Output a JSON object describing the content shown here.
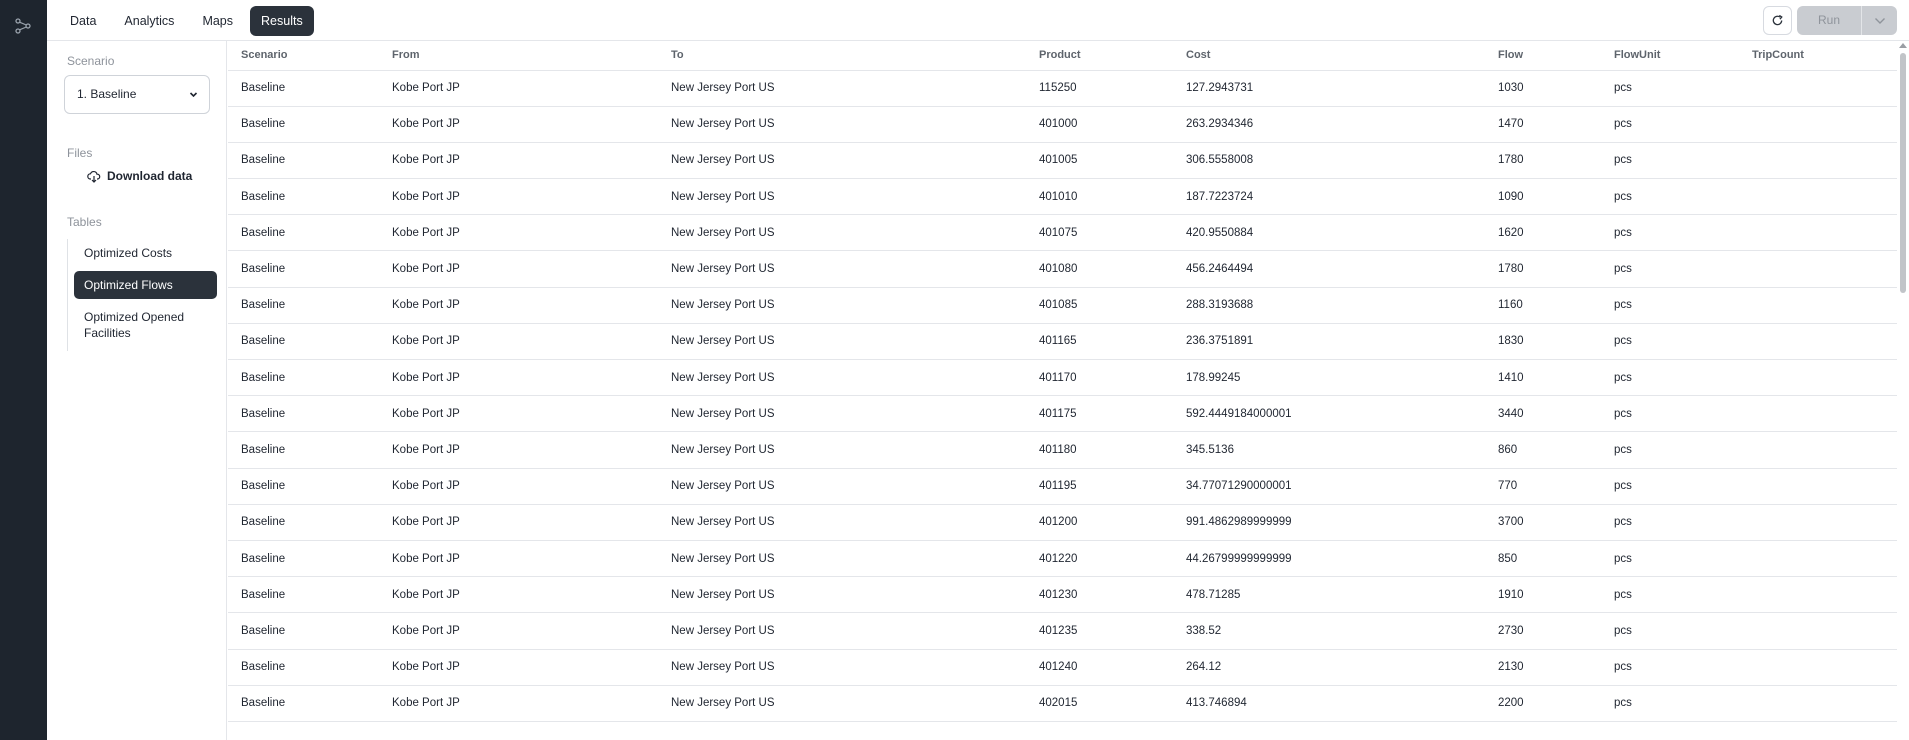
{
  "nav": {
    "tabs": [
      {
        "label": "Data",
        "active": false
      },
      {
        "label": "Analytics",
        "active": false
      },
      {
        "label": "Maps",
        "active": false
      },
      {
        "label": "Results",
        "active": true
      }
    ],
    "run_label": "Run"
  },
  "sidebar": {
    "scenario_title": "Scenario",
    "scenario_value": "1. Baseline",
    "files_title": "Files",
    "download_label": "Download data",
    "tables_title": "Tables",
    "tables": [
      {
        "label": "Optimized Costs",
        "active": false
      },
      {
        "label": "Optimized Flows",
        "active": true
      },
      {
        "label": "Optimized Opened Facilities",
        "active": false
      }
    ]
  },
  "table": {
    "headers": [
      "Scenario",
      "From",
      "To",
      "Product",
      "Cost",
      "Flow",
      "FlowUnit",
      "TripCount"
    ],
    "rows": [
      [
        "Baseline",
        "Kobe Port JP",
        "New Jersey Port US",
        "115250",
        "127.2943731",
        "1030",
        "pcs",
        ""
      ],
      [
        "Baseline",
        "Kobe Port JP",
        "New Jersey Port US",
        "401000",
        "263.2934346",
        "1470",
        "pcs",
        ""
      ],
      [
        "Baseline",
        "Kobe Port JP",
        "New Jersey Port US",
        "401005",
        "306.5558008",
        "1780",
        "pcs",
        ""
      ],
      [
        "Baseline",
        "Kobe Port JP",
        "New Jersey Port US",
        "401010",
        "187.7223724",
        "1090",
        "pcs",
        ""
      ],
      [
        "Baseline",
        "Kobe Port JP",
        "New Jersey Port US",
        "401075",
        "420.9550884",
        "1620",
        "pcs",
        ""
      ],
      [
        "Baseline",
        "Kobe Port JP",
        "New Jersey Port US",
        "401080",
        "456.2464494",
        "1780",
        "pcs",
        ""
      ],
      [
        "Baseline",
        "Kobe Port JP",
        "New Jersey Port US",
        "401085",
        "288.3193688",
        "1160",
        "pcs",
        ""
      ],
      [
        "Baseline",
        "Kobe Port JP",
        "New Jersey Port US",
        "401165",
        "236.3751891",
        "1830",
        "pcs",
        ""
      ],
      [
        "Baseline",
        "Kobe Port JP",
        "New Jersey Port US",
        "401170",
        "178.99245",
        "1410",
        "pcs",
        ""
      ],
      [
        "Baseline",
        "Kobe Port JP",
        "New Jersey Port US",
        "401175",
        "592.4449184000001",
        "3440",
        "pcs",
        ""
      ],
      [
        "Baseline",
        "Kobe Port JP",
        "New Jersey Port US",
        "401180",
        "345.5136",
        "860",
        "pcs",
        ""
      ],
      [
        "Baseline",
        "Kobe Port JP",
        "New Jersey Port US",
        "401195",
        "34.77071290000001",
        "770",
        "pcs",
        ""
      ],
      [
        "Baseline",
        "Kobe Port JP",
        "New Jersey Port US",
        "401200",
        "991.4862989999999",
        "3700",
        "pcs",
        ""
      ],
      [
        "Baseline",
        "Kobe Port JP",
        "New Jersey Port US",
        "401220",
        "44.26799999999999",
        "850",
        "pcs",
        ""
      ],
      [
        "Baseline",
        "Kobe Port JP",
        "New Jersey Port US",
        "401230",
        "478.71285",
        "1910",
        "pcs",
        ""
      ],
      [
        "Baseline",
        "Kobe Port JP",
        "New Jersey Port US",
        "401235",
        "338.52",
        "2730",
        "pcs",
        ""
      ],
      [
        "Baseline",
        "Kobe Port JP",
        "New Jersey Port US",
        "401240",
        "264.12",
        "2130",
        "pcs",
        ""
      ],
      [
        "Baseline",
        "Kobe Port JP",
        "New Jersey Port US",
        "402015",
        "413.746894",
        "2200",
        "pcs",
        ""
      ]
    ]
  }
}
